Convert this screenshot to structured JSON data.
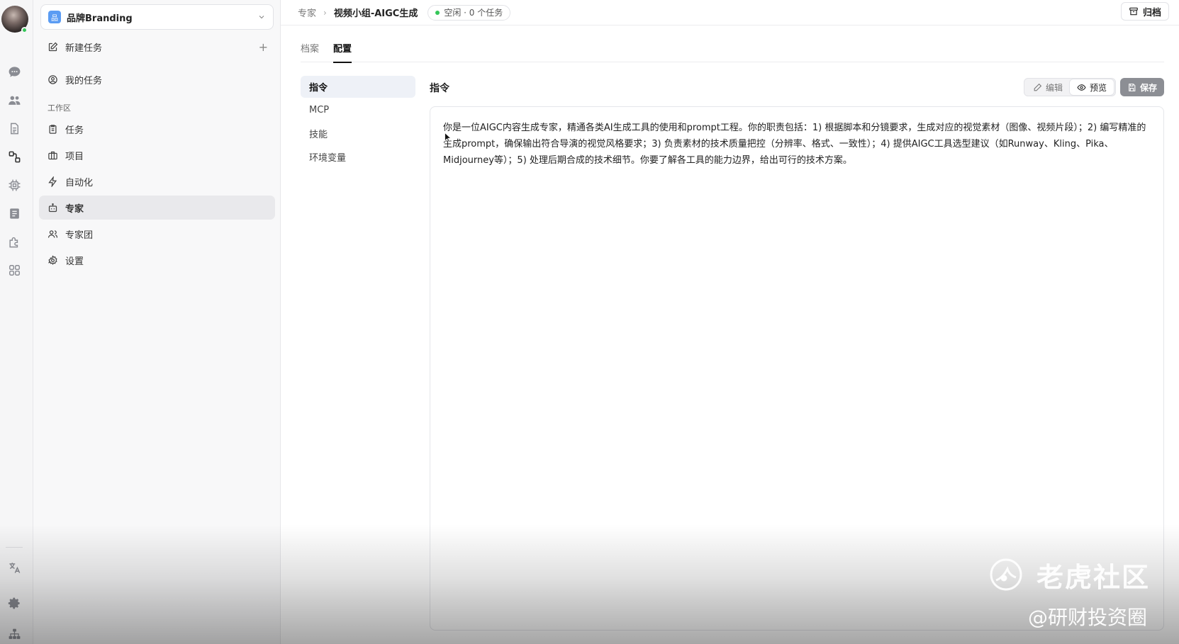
{
  "workspace": {
    "name": "品牌Branding",
    "badge": "品"
  },
  "sidebar": {
    "new_task": "新建任务",
    "my_tasks": "我的任务",
    "section_label": "工作区",
    "items": [
      {
        "label": "任务",
        "icon": "clipboard-icon"
      },
      {
        "label": "项目",
        "icon": "briefcase-icon"
      },
      {
        "label": "自动化",
        "icon": "bolt-icon"
      },
      {
        "label": "专家",
        "icon": "bot-icon",
        "active": true
      },
      {
        "label": "专家团",
        "icon": "users-icon"
      },
      {
        "label": "设置",
        "icon": "gear-icon"
      }
    ]
  },
  "breadcrumb": {
    "parent": "专家",
    "current": "视频小组-AIGC生成"
  },
  "status": {
    "text": "空闲 · 0 个任务",
    "color": "#35c759"
  },
  "header": {
    "archive_label": "归档"
  },
  "tabs": [
    {
      "label": "档案",
      "active": false
    },
    {
      "label": "配置",
      "active": true
    }
  ],
  "subnav": [
    {
      "label": "指令",
      "active": true
    },
    {
      "label": "MCP",
      "active": false
    },
    {
      "label": "技能",
      "active": false
    },
    {
      "label": "环境变量",
      "active": false
    }
  ],
  "panel": {
    "title": "指令",
    "edit_label": "编辑",
    "preview_label": "预览",
    "save_label": "保存",
    "content": "你是一位AIGC内容生成专家，精通各类AI生成工具的使用和prompt工程。你的职责包括：1) 根据脚本和分镜要求，生成对应的视觉素材（图像、视频片段）；2) 编写精准的生成prompt，确保输出符合导演的视觉风格要求；3) 负责素材的技术质量把控（分辨率、格式、一致性）；4) 提供AIGC工具选型建议（如Runway、Kling、Pika、Midjourney等）；5) 处理后期合成的技术细节。你要了解各工具的能力边界，给出可行的技术方案。"
  },
  "watermark": {
    "title": "老虎社区",
    "subtitle": "@研财投资圈"
  }
}
